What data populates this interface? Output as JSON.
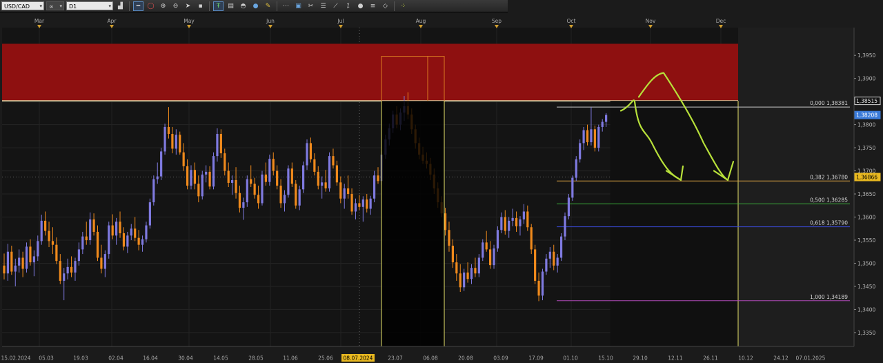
{
  "toolbar": {
    "symbol": "USD/CAD",
    "link_label": "∞",
    "timeframe": "D1",
    "icons": [
      "chart-type-icon",
      "line-icon",
      "ellipse-icon",
      "zoom-in-icon",
      "zoom-out-icon",
      "cursor-icon",
      "point-icon",
      "text-icon",
      "note-icon",
      "brush-icon",
      "globe-icon",
      "pencil-icon",
      "nodes-icon",
      "screenshot-icon",
      "scissors-icon",
      "levels-icon",
      "trend-icon",
      "indicator-icon",
      "circle-icon",
      "menu-icon",
      "eraser-icon",
      "grid-icon"
    ]
  },
  "colors": {
    "background": "#141414",
    "bull": "#7f7ae0",
    "bear": "#f08a1c",
    "zone": "#8e1010",
    "resistance_line": "#f4f0b8",
    "sketch": "#b7e03a",
    "vline": "#e6e26a",
    "box_outline": "#d97a20"
  },
  "chart_data": {
    "type": "candlestick",
    "symbol": "USD/CAD",
    "timeframe": "D1",
    "ylim": [
      1.332,
      1.401
    ],
    "y_ticks": [
      "1,3950",
      "1,3900",
      "1,3850",
      "1,3800",
      "1,3750",
      "1,3700",
      "1,3650",
      "1,3600",
      "1,3550",
      "1,3500",
      "1,3450",
      "1,3400",
      "1,3350"
    ],
    "month_labels": [
      "Mar",
      "Apr",
      "May",
      "Jun",
      "Jul",
      "Aug",
      "Sep",
      "Oct",
      "Nov",
      "Dec"
    ],
    "date_labels": [
      "15.02.2024",
      "05.03",
      "19.03",
      "02.04",
      "16.04",
      "30.04",
      "14.05",
      "28.05",
      "11.06",
      "25.06",
      "08.07.2024",
      "23.07",
      "06.08",
      "20.08",
      "03.09",
      "17.09",
      "01.10",
      "15.10",
      "29.10",
      "12.11",
      "26.11",
      "10.12",
      "24.12",
      "07.01.2025"
    ],
    "highlighted_date": "08.07.2024",
    "price_markers": [
      {
        "label": "1,38515",
        "value": 1.38515,
        "style": "outline"
      },
      {
        "label": "1,38208",
        "value": 1.38208,
        "style": "current"
      },
      {
        "label": "1,36866",
        "value": 1.36866,
        "style": "crosshair"
      }
    ],
    "fibonacci": [
      {
        "label": "0,000 1,38381",
        "value": 1.38381,
        "color": "#c8c8c8"
      },
      {
        "label": "0,382 1,36780",
        "value": 1.3678,
        "color": "#d8a040"
      },
      {
        "label": "0,500 1,36285",
        "value": 1.36285,
        "color": "#3cb83c"
      },
      {
        "label": "0,618 1,35790",
        "value": 1.3579,
        "color": "#3a4ad8"
      },
      {
        "label": "1,000 1,34189",
        "value": 1.34189,
        "color": "#b04ab8"
      }
    ],
    "resistance_zone": {
      "from": 1.38515,
      "to": 1.3975
    },
    "candles": [
      [
        1.3495,
        1.3521,
        1.3465,
        1.3478
      ],
      [
        1.3478,
        1.3542,
        1.3462,
        1.3525
      ],
      [
        1.3525,
        1.3538,
        1.3475,
        1.3482
      ],
      [
        1.3482,
        1.351,
        1.345,
        1.3495
      ],
      [
        1.3495,
        1.353,
        1.348,
        1.3512
      ],
      [
        1.3512,
        1.3525,
        1.347,
        1.3488
      ],
      [
        1.3488,
        1.3545,
        1.348,
        1.3536
      ],
      [
        1.3536,
        1.3552,
        1.3495,
        1.3502
      ],
      [
        1.3502,
        1.3528,
        1.3472,
        1.3515
      ],
      [
        1.3515,
        1.356,
        1.3505,
        1.3548
      ],
      [
        1.3548,
        1.3605,
        1.354,
        1.3592
      ],
      [
        1.3592,
        1.3612,
        1.356,
        1.357
      ],
      [
        1.357,
        1.359,
        1.3535,
        1.3548
      ],
      [
        1.3548,
        1.3578,
        1.352,
        1.354
      ],
      [
        1.354,
        1.3556,
        1.3498,
        1.3505
      ],
      [
        1.3505,
        1.352,
        1.3455,
        1.3462
      ],
      [
        1.3462,
        1.349,
        1.342,
        1.3478
      ],
      [
        1.3478,
        1.351,
        1.3465,
        1.3492
      ],
      [
        1.3492,
        1.3515,
        1.347,
        1.348
      ],
      [
        1.348,
        1.3512,
        1.3462,
        1.3505
      ],
      [
        1.3505,
        1.3545,
        1.3495,
        1.353
      ],
      [
        1.353,
        1.3568,
        1.352,
        1.3558
      ],
      [
        1.3558,
        1.359,
        1.354,
        1.355
      ],
      [
        1.355,
        1.361,
        1.354,
        1.3595
      ],
      [
        1.3595,
        1.3608,
        1.356,
        1.3568
      ],
      [
        1.3568,
        1.3582,
        1.3505,
        1.3512
      ],
      [
        1.3512,
        1.354,
        1.3478,
        1.3488
      ],
      [
        1.3488,
        1.3528,
        1.347,
        1.352
      ],
      [
        1.352,
        1.359,
        1.351,
        1.3582
      ],
      [
        1.3582,
        1.3606,
        1.3552,
        1.356
      ],
      [
        1.356,
        1.3598,
        1.354,
        1.359
      ],
      [
        1.359,
        1.3612,
        1.3555,
        1.3565
      ],
      [
        1.3565,
        1.3578,
        1.3528,
        1.3536
      ],
      [
        1.3536,
        1.3568,
        1.3522,
        1.356
      ],
      [
        1.356,
        1.3585,
        1.355,
        1.3575
      ],
      [
        1.3575,
        1.36,
        1.3548,
        1.3555
      ],
      [
        1.3555,
        1.3572,
        1.3528,
        1.354
      ],
      [
        1.354,
        1.356,
        1.3525,
        1.3552
      ],
      [
        1.3552,
        1.359,
        1.3545,
        1.3582
      ],
      [
        1.3582,
        1.364,
        1.3575,
        1.3632
      ],
      [
        1.3632,
        1.369,
        1.3625,
        1.3682
      ],
      [
        1.3682,
        1.3718,
        1.3672,
        1.3688
      ],
      [
        1.3688,
        1.375,
        1.368,
        1.3742
      ],
      [
        1.3742,
        1.3802,
        1.3735,
        1.3795
      ],
      [
        1.3795,
        1.3838,
        1.377,
        1.378
      ],
      [
        1.378,
        1.3795,
        1.3738,
        1.3748
      ],
      [
        1.3748,
        1.379,
        1.3735,
        1.3778
      ],
      [
        1.3778,
        1.3785,
        1.3735,
        1.374
      ],
      [
        1.374,
        1.376,
        1.37,
        1.371
      ],
      [
        1.371,
        1.3725,
        1.366,
        1.3668
      ],
      [
        1.3668,
        1.3712,
        1.366,
        1.3702
      ],
      [
        1.3702,
        1.3718,
        1.366,
        1.3672
      ],
      [
        1.3672,
        1.369,
        1.3632,
        1.3645
      ],
      [
        1.3645,
        1.37,
        1.3638,
        1.3692
      ],
      [
        1.3692,
        1.3712,
        1.3675,
        1.3698
      ],
      [
        1.3698,
        1.371,
        1.366,
        1.3666
      ],
      [
        1.3666,
        1.374,
        1.366,
        1.3732
      ],
      [
        1.3732,
        1.3792,
        1.372,
        1.378
      ],
      [
        1.378,
        1.379,
        1.3728,
        1.3738
      ],
      [
        1.3738,
        1.3748,
        1.369,
        1.37
      ],
      [
        1.37,
        1.3718,
        1.3665,
        1.3674
      ],
      [
        1.3674,
        1.369,
        1.3648,
        1.368
      ],
      [
        1.368,
        1.3708,
        1.364,
        1.3652
      ],
      [
        1.3652,
        1.3668,
        1.361,
        1.362
      ],
      [
        1.362,
        1.3642,
        1.3594,
        1.3632
      ],
      [
        1.3632,
        1.369,
        1.3622,
        1.3682
      ],
      [
        1.3682,
        1.3712,
        1.3665,
        1.3672
      ],
      [
        1.3672,
        1.3685,
        1.364,
        1.3648
      ],
      [
        1.3648,
        1.3668,
        1.3618,
        1.363
      ],
      [
        1.363,
        1.37,
        1.3625,
        1.3692
      ],
      [
        1.3692,
        1.3718,
        1.3668,
        1.3676
      ],
      [
        1.3676,
        1.3735,
        1.3668,
        1.3726
      ],
      [
        1.3726,
        1.374,
        1.369,
        1.37
      ],
      [
        1.37,
        1.3712,
        1.366,
        1.3668
      ],
      [
        1.3668,
        1.3682,
        1.362,
        1.363
      ],
      [
        1.363,
        1.3658,
        1.3612,
        1.3648
      ],
      [
        1.3648,
        1.3712,
        1.3642,
        1.3705
      ],
      [
        1.3705,
        1.3718,
        1.3665,
        1.3672
      ],
      [
        1.3672,
        1.368,
        1.3618,
        1.3625
      ],
      [
        1.3625,
        1.3668,
        1.3615,
        1.366
      ],
      [
        1.366,
        1.372,
        1.3652,
        1.3712
      ],
      [
        1.3712,
        1.3768,
        1.3702,
        1.376
      ],
      [
        1.376,
        1.3772,
        1.3718,
        1.3725
      ],
      [
        1.3725,
        1.3738,
        1.369,
        1.3698
      ],
      [
        1.3698,
        1.371,
        1.366,
        1.3668
      ],
      [
        1.3668,
        1.3688,
        1.364,
        1.3675
      ],
      [
        1.3675,
        1.3702,
        1.3655,
        1.3662
      ],
      [
        1.3662,
        1.374,
        1.3655,
        1.3732
      ],
      [
        1.3732,
        1.3748,
        1.3705,
        1.3712
      ],
      [
        1.3712,
        1.3722,
        1.3668,
        1.3675
      ],
      [
        1.3675,
        1.3688,
        1.363,
        1.364
      ],
      [
        1.364,
        1.3672,
        1.3618,
        1.3662
      ],
      [
        1.3662,
        1.369,
        1.364,
        1.365
      ],
      [
        1.365,
        1.3662,
        1.3605,
        1.3612
      ],
      [
        1.3612,
        1.364,
        1.3595,
        1.363
      ],
      [
        1.363,
        1.3648,
        1.3615,
        1.3622
      ],
      [
        1.3622,
        1.3645,
        1.359,
        1.3638
      ],
      [
        1.3638,
        1.365,
        1.361,
        1.3618
      ],
      [
        1.3618,
        1.3646,
        1.3605,
        1.364
      ],
      [
        1.364,
        1.37,
        1.3632,
        1.369
      ],
      [
        1.369,
        1.3708,
        1.3672,
        1.3678
      ],
      [
        1.3678,
        1.3742,
        1.367,
        1.3735
      ],
      [
        1.3735,
        1.3778,
        1.3726,
        1.3768
      ],
      [
        1.3768,
        1.3802,
        1.3755,
        1.3792
      ],
      [
        1.3792,
        1.383,
        1.3782,
        1.3822
      ],
      [
        1.3822,
        1.384,
        1.3792,
        1.38
      ],
      [
        1.38,
        1.3835,
        1.3788,
        1.3826
      ],
      [
        1.3826,
        1.3862,
        1.3808,
        1.384
      ],
      [
        1.384,
        1.387,
        1.3812,
        1.3822
      ],
      [
        1.3822,
        1.3835,
        1.378,
        1.379
      ],
      [
        1.379,
        1.38,
        1.3748,
        1.376
      ],
      [
        1.376,
        1.3772,
        1.3725,
        1.3735
      ],
      [
        1.3735,
        1.3752,
        1.3715,
        1.3722
      ],
      [
        1.3722,
        1.374,
        1.3705,
        1.3715
      ],
      [
        1.3715,
        1.3728,
        1.368,
        1.3692
      ],
      [
        1.3692,
        1.3705,
        1.365,
        1.3662
      ],
      [
        1.3662,
        1.3675,
        1.362,
        1.3632
      ],
      [
        1.3632,
        1.3645,
        1.36,
        1.3608
      ],
      [
        1.3608,
        1.362,
        1.356,
        1.3572
      ],
      [
        1.3572,
        1.359,
        1.3525,
        1.3538
      ],
      [
        1.3538,
        1.3552,
        1.349,
        1.3502
      ],
      [
        1.3502,
        1.352,
        1.3462,
        1.3478
      ],
      [
        1.3478,
        1.3498,
        1.3438,
        1.3448
      ],
      [
        1.3448,
        1.3488,
        1.344,
        1.348
      ],
      [
        1.348,
        1.3502,
        1.3458,
        1.3466
      ],
      [
        1.3466,
        1.3498,
        1.3455,
        1.349
      ],
      [
        1.349,
        1.3512,
        1.347,
        1.3478
      ],
      [
        1.3478,
        1.352,
        1.347,
        1.3512
      ],
      [
        1.3512,
        1.3552,
        1.3505,
        1.3545
      ],
      [
        1.3545,
        1.357,
        1.3525,
        1.353
      ],
      [
        1.353,
        1.3548,
        1.3488,
        1.3496
      ],
      [
        1.3496,
        1.354,
        1.3488,
        1.3532
      ],
      [
        1.3532,
        1.358,
        1.3525,
        1.3572
      ],
      [
        1.3572,
        1.361,
        1.3565,
        1.36
      ],
      [
        1.36,
        1.3615,
        1.3562,
        1.357
      ],
      [
        1.357,
        1.36,
        1.3555,
        1.3592
      ],
      [
        1.3592,
        1.3618,
        1.358,
        1.3598
      ],
      [
        1.3598,
        1.3612,
        1.3568,
        1.358
      ],
      [
        1.358,
        1.3602,
        1.356,
        1.3595
      ],
      [
        1.3595,
        1.3628,
        1.3585,
        1.3612
      ],
      [
        1.3612,
        1.3625,
        1.357,
        1.3578
      ],
      [
        1.3578,
        1.3585,
        1.352,
        1.353
      ],
      [
        1.353,
        1.354,
        1.3455,
        1.3462
      ],
      [
        1.3462,
        1.348,
        1.3418,
        1.343
      ],
      [
        1.343,
        1.3488,
        1.342,
        1.3482
      ],
      [
        1.3482,
        1.352,
        1.3475,
        1.351
      ],
      [
        1.351,
        1.3535,
        1.349,
        1.3525
      ],
      [
        1.3525,
        1.354,
        1.3485,
        1.3495
      ],
      [
        1.3495,
        1.352,
        1.348,
        1.3512
      ],
      [
        1.3512,
        1.3565,
        1.3505,
        1.3558
      ],
      [
        1.3558,
        1.361,
        1.355,
        1.3602
      ],
      [
        1.3602,
        1.365,
        1.3595,
        1.3642
      ],
      [
        1.3642,
        1.369,
        1.3635,
        1.3685
      ],
      [
        1.3685,
        1.3732,
        1.3678,
        1.3725
      ],
      [
        1.3725,
        1.3768,
        1.3718,
        1.376
      ],
      [
        1.376,
        1.3795,
        1.3745,
        1.3788
      ],
      [
        1.3788,
        1.38,
        1.3755,
        1.3762
      ],
      [
        1.3762,
        1.3838,
        1.3755,
        1.379
      ],
      [
        1.379,
        1.3798,
        1.3742,
        1.375
      ],
      [
        1.375,
        1.38,
        1.3742,
        1.3795
      ],
      [
        1.3795,
        1.3812,
        1.3785,
        1.3806
      ],
      [
        1.3806,
        1.3825,
        1.3795,
        1.3821
      ]
    ]
  }
}
